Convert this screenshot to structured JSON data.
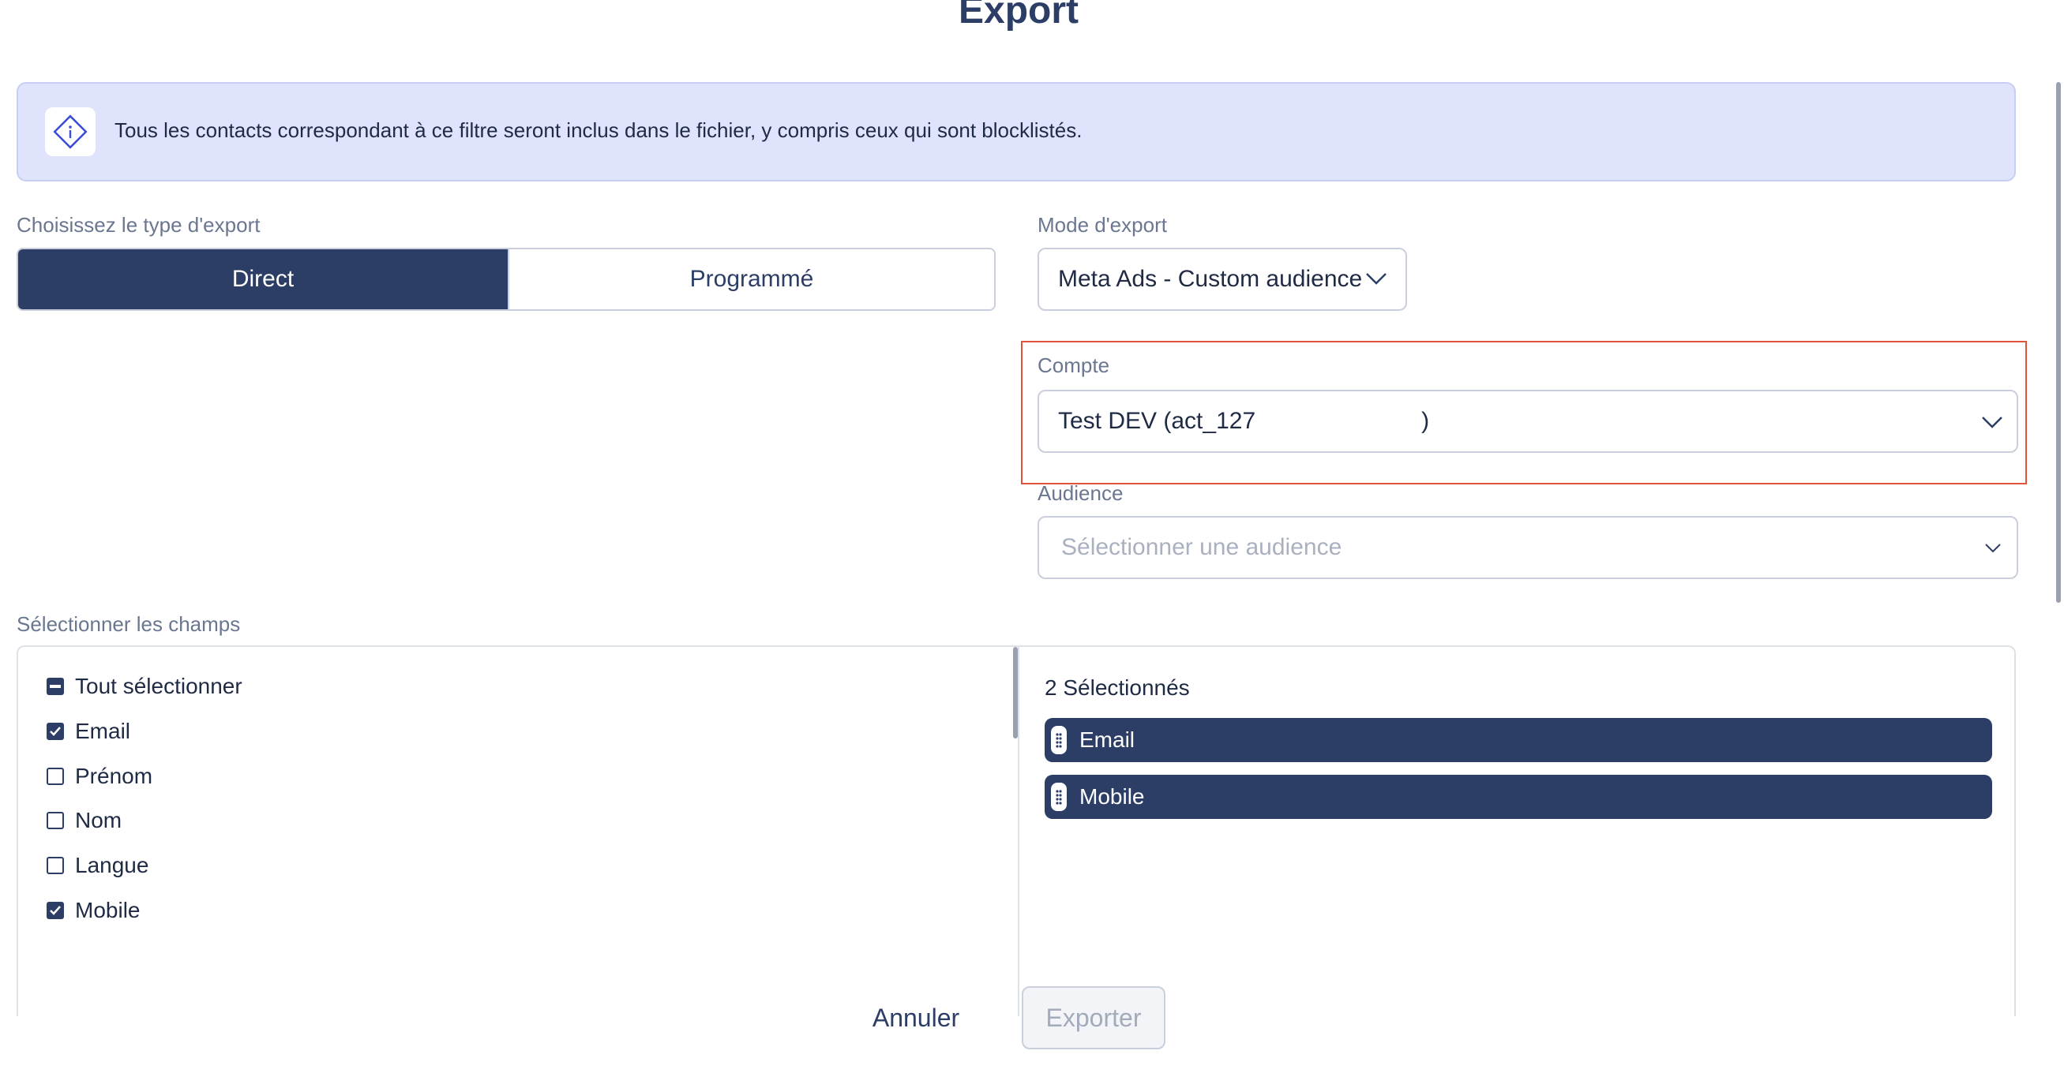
{
  "dialog": {
    "title": "Export"
  },
  "info": {
    "text": "Tous les contacts correspondant à ce filtre seront inclus dans le fichier, y compris ceux qui sont blocklistés.",
    "icon": "info-diamond-icon"
  },
  "export_type": {
    "label": "Choisissez le type d'export",
    "options": [
      "Direct",
      "Programmé"
    ],
    "selected": "Direct"
  },
  "export_mode": {
    "label": "Mode d'export",
    "value": "Meta Ads - Custom audience"
  },
  "account": {
    "label": "Compte",
    "value": "Test DEV (act_127",
    "suffix": ")"
  },
  "audience": {
    "label": "Audience",
    "placeholder": "Sélectionner une audience"
  },
  "fields": {
    "label": "Sélectionner les champs",
    "select_all": "Tout sélectionner",
    "items": [
      {
        "label": "Email",
        "checked": true
      },
      {
        "label": "Prénom",
        "checked": false
      },
      {
        "label": "Nom",
        "checked": false
      },
      {
        "label": "Langue",
        "checked": false
      },
      {
        "label": "Mobile",
        "checked": true
      }
    ],
    "selected_count": "2 Sélectionnés",
    "selected": [
      "Email",
      "Mobile"
    ]
  },
  "actions": {
    "cancel": "Annuler",
    "export": "Exporter"
  },
  "colors": {
    "primary": "#2c3e66",
    "banner_bg": "#dfe3fb",
    "highlight": "#e0533b"
  }
}
